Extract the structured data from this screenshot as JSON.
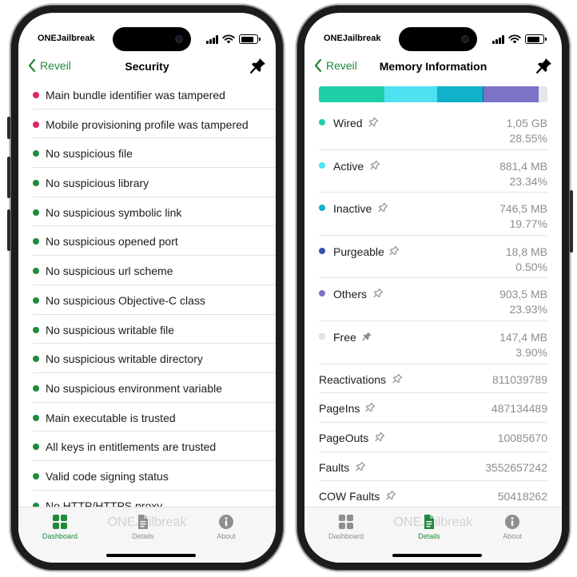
{
  "status_bar": {
    "carrier": "ONEJailbreak"
  },
  "left_screen": {
    "nav": {
      "back_label": "Reveil",
      "title": "Security"
    },
    "items": [
      {
        "text": "Main bundle identifier was tampered",
        "status_color": "#e0245e"
      },
      {
        "text": "Mobile provisioning profile was tampered",
        "status_color": "#e0245e"
      },
      {
        "text": "No suspicious file",
        "status_color": "#1f8a3a"
      },
      {
        "text": "No suspicious library",
        "status_color": "#1f8a3a"
      },
      {
        "text": "No suspicious symbolic link",
        "status_color": "#1f8a3a"
      },
      {
        "text": "No suspicious opened port",
        "status_color": "#1f8a3a"
      },
      {
        "text": "No suspicious url scheme",
        "status_color": "#1f8a3a"
      },
      {
        "text": "No suspicious Objective-C class",
        "status_color": "#1f8a3a"
      },
      {
        "text": "No suspicious writable file",
        "status_color": "#1f8a3a"
      },
      {
        "text": "No suspicious writable directory",
        "status_color": "#1f8a3a"
      },
      {
        "text": "No suspicious environment variable",
        "status_color": "#1f8a3a"
      },
      {
        "text": "Main executable is trusted",
        "status_color": "#1f8a3a"
      },
      {
        "text": "All keys in entitlements are trusted",
        "status_color": "#1f8a3a"
      },
      {
        "text": "Valid code signing status",
        "status_color": "#1f8a3a"
      },
      {
        "text": "No HTTP/HTTPS proxy",
        "status_color": "#1f8a3a"
      }
    ],
    "active_tab": "dashboard"
  },
  "right_screen": {
    "nav": {
      "back_label": "Reveil",
      "title": "Memory Information"
    },
    "memory_bar": [
      {
        "name": "Wired",
        "fraction": 0.2855,
        "color": "#1fcfa8"
      },
      {
        "name": "Active",
        "fraction": 0.2334,
        "color": "#4fe0f2"
      },
      {
        "name": "Inactive",
        "fraction": 0.1977,
        "color": "#10b1c9"
      },
      {
        "name": "Purgeable",
        "fraction": 0.005,
        "color": "#3a4fae"
      },
      {
        "name": "Others",
        "fraction": 0.2393,
        "color": "#7a73c8"
      },
      {
        "name": "Free",
        "fraction": 0.039,
        "color": "#e6e6ea"
      }
    ],
    "memory_rows": [
      {
        "label": "Wired",
        "size": "1,05 GB",
        "percent": "28.55%",
        "color": "#1fcfa8",
        "pinned": false
      },
      {
        "label": "Active",
        "size": "881,4 MB",
        "percent": "23.34%",
        "color": "#4fe0f2",
        "pinned": false
      },
      {
        "label": "Inactive",
        "size": "746,5 MB",
        "percent": "19.77%",
        "color": "#10b1c9",
        "pinned": false
      },
      {
        "label": "Purgeable",
        "size": "18,8 MB",
        "percent": "0.50%",
        "color": "#3a4fae",
        "pinned": false
      },
      {
        "label": "Others",
        "size": "903,5 MB",
        "percent": "23.93%",
        "color": "#7a73c8",
        "pinned": false
      },
      {
        "label": "Free",
        "size": "147,4 MB",
        "percent": "3.90%",
        "color": "#e6e6ea",
        "pinned": true
      }
    ],
    "stat_rows": [
      {
        "label": "Reactivations",
        "value": "811039789"
      },
      {
        "label": "PageIns",
        "value": "487134489"
      },
      {
        "label": "PageOuts",
        "value": "10085670"
      },
      {
        "label": "Faults",
        "value": "3552657242"
      },
      {
        "label": "COW Faults",
        "value": "50418262"
      }
    ],
    "active_tab": "details"
  },
  "tabbar": {
    "tabs": [
      {
        "id": "dashboard",
        "label": "Dashboard",
        "icon": "grid-icon"
      },
      {
        "id": "details",
        "label": "Details",
        "icon": "document-icon"
      },
      {
        "id": "about",
        "label": "About",
        "icon": "info-icon"
      }
    ],
    "watermark": "ONEJailbreak"
  },
  "colors": {
    "accent": "#1f8a3a",
    "secondary_text": "#8e8e93",
    "separator": "#e3e3e7"
  }
}
